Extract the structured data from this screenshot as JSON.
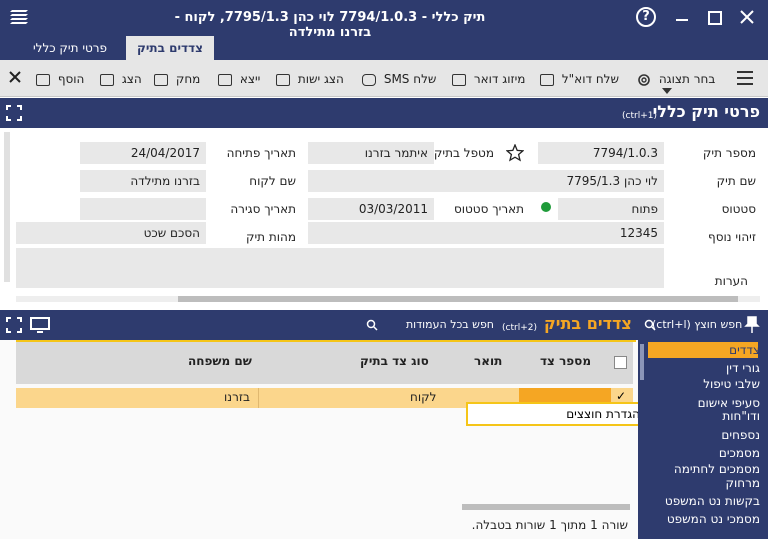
{
  "window": {
    "title": "תיק כללי - 7794/1.0.3 לוי  כהן 7795/1.3, לקוח - בזרנו מתילדה",
    "help_glyph": "?",
    "min_glyph": "–",
    "max_glyph": "☐",
    "close_glyph": "✕"
  },
  "tabs": [
    {
      "label": "פרטי תיק כללי"
    },
    {
      "label": "צדדים בתיק"
    }
  ],
  "toolbar": {
    "view_label": "בחר תצוגה",
    "email_label": "שלח דוא\"ל",
    "merge_label": "מיזוג דואר",
    "sms_label": "שלח SMS",
    "entities_label": "הצג ישות",
    "export_label": "ייצא",
    "delete_label": "מחק",
    "show_label": "הצג",
    "add_label": "הוסף"
  },
  "details": {
    "title": "פרטי תיק כללי",
    "shortcut": "(ctrl+1)",
    "file_number_label": "מספר תיק",
    "file_number": "7794/1.0.3",
    "handler_label": "מטפל בתיק",
    "handler": "איתמר בזרנו",
    "open_date_label": "תאריך פתיחה",
    "open_date": "24/04/2017",
    "file_name_label": "שם תיק",
    "file_name": "לוי  כהן 7795/1.3",
    "client_name_label": "שם לקוח",
    "client_name": "בזרנו מתילדה",
    "status_label": "סטטוס",
    "status": "פתוח",
    "status_date_label": "תאריך סטטוס",
    "status_date": "03/03/2011",
    "close_date_label": "תאריך סגירה",
    "close_date": "",
    "extra_id_label": "זיהוי נוסף",
    "extra_id": "12345",
    "file_essence_label": "מהות תיק",
    "file_essence": "הסכם שכט",
    "notes_label": "הערות",
    "notes": ""
  },
  "parties": {
    "title": "צדדים בתיק",
    "shortcut": "(ctrl+2)",
    "search_placeholder": "חפש בכל העמודות",
    "columns": [
      "מספר צד",
      "תואר",
      "סוג צד בתיק",
      "שם משפחה"
    ],
    "rows": [
      {
        "number": "",
        "title": "",
        "type": "לקוח",
        "last_name": "בזרנו"
      }
    ],
    "context_menu_item": "הגדרת חוצצים",
    "footer": "שורה 1 מתוך 1 שורות בטבלה."
  },
  "sidebar": {
    "search_label": "חפש חוצץ (ctrl+l)",
    "items": [
      "צדדים",
      "גורי דין",
      "שלבי טיפול",
      "סעיפי אישום",
      "ודו\"חות",
      "נספחים",
      "מסמכים",
      "מסמכים לחתימה",
      "מרחוק",
      "בקשות נט המשפט",
      "מסמכי נט המשפט"
    ]
  },
  "colors": {
    "navy": "#2e3b6e",
    "highlight": "#fbd68c",
    "orange": "#f5a623",
    "status_green": "#1f9b3a"
  }
}
